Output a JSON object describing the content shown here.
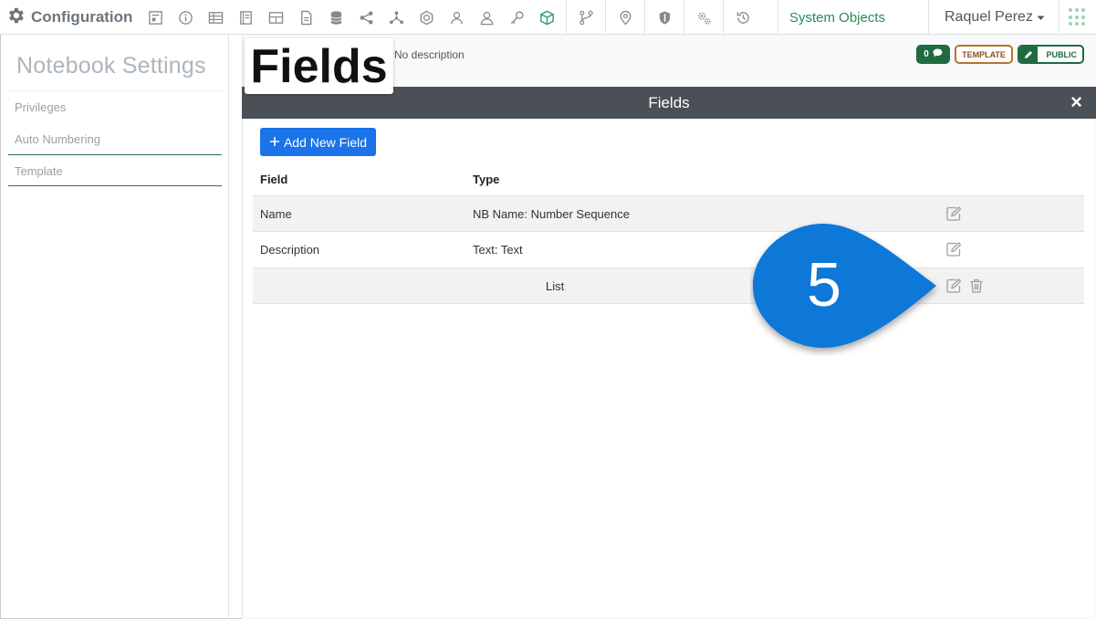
{
  "app": {
    "title": "Configuration",
    "system_objects": "System Objects",
    "user_name": "Raquel Perez",
    "toolbar_icons": [
      "form-icon",
      "info-icon",
      "table-icon",
      "notebook-icon",
      "grid-icon",
      "document-icon",
      "database-icon",
      "share-icon",
      "network-icon",
      "badge-icon",
      "users-icon",
      "user-icon",
      "key-icon",
      "cube-icon",
      "workflow-icon",
      "location-icon",
      "shield-icon",
      "gears-icon",
      "history-icon"
    ]
  },
  "sidebar": {
    "title": "Notebook Settings",
    "items": [
      {
        "label": "Privileges"
      },
      {
        "label": "Auto Numbering"
      },
      {
        "label": "Template"
      }
    ]
  },
  "page": {
    "callout_title": "Fields",
    "description": "No description",
    "badges": {
      "count": "0",
      "template": "TEMPLATE",
      "public": "PUBLIC"
    }
  },
  "modal": {
    "title": "Fields",
    "close": "×",
    "add_button": "Add New Field",
    "columns": {
      "field": "Field",
      "type": "Type"
    },
    "rows": [
      {
        "field": "Name",
        "type": "NB Name: Number Sequence"
      },
      {
        "field": "Description",
        "type": "Text: Text"
      },
      {
        "field": "",
        "type": "List"
      }
    ]
  },
  "step_marker": {
    "number": "5"
  },
  "colors": {
    "accent_blue": "#1a73e8",
    "brand_green": "#1e6b3f",
    "template_orange": "#b5762c",
    "marker_blue": "#0b78d8",
    "header_dark": "#4a5056"
  }
}
